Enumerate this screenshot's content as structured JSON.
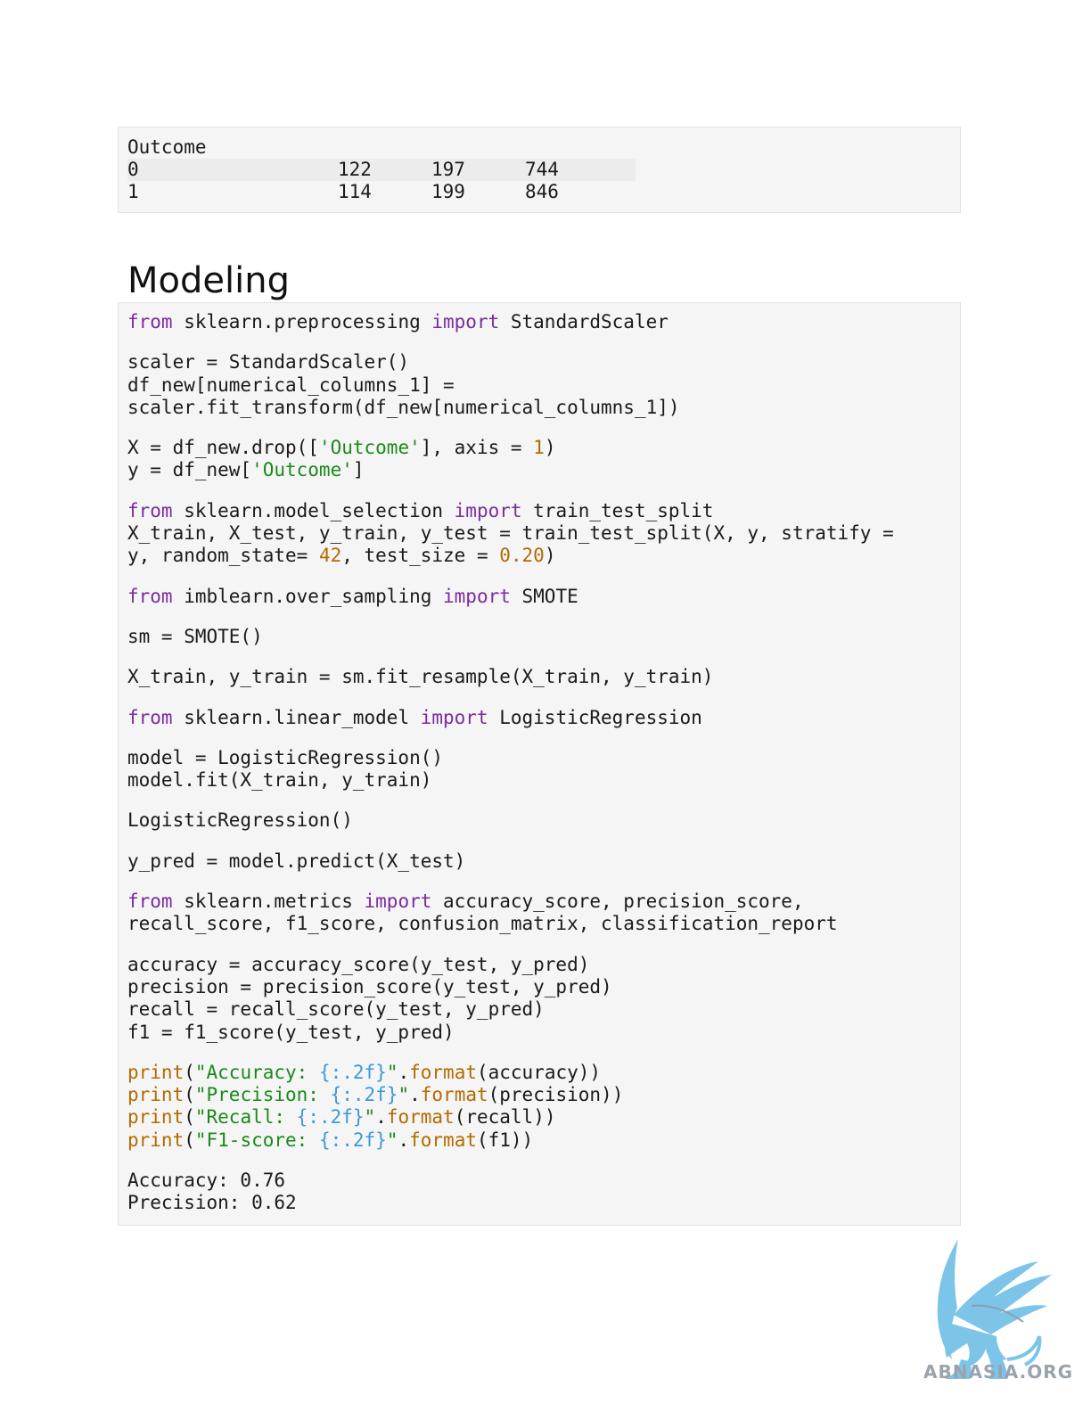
{
  "output_table": {
    "header": "Outcome",
    "rows": [
      {
        "label": "0",
        "v1": "122",
        "v2": "197",
        "v3": "744"
      },
      {
        "label": "1",
        "v1": "114",
        "v2": "199",
        "v3": "846"
      }
    ]
  },
  "heading": "Modeling",
  "code": {
    "l1": {
      "a": "from",
      "b": " sklearn.preprocessing ",
      "c": "import",
      "d": " StandardScaler"
    },
    "l2": "scaler = StandardScaler()",
    "l3": "df_new[numerical_columns_1] =",
    "l4": "scaler.fit_transform(df_new[numerical_columns_1])",
    "l5": {
      "a": "X = df_new.drop([",
      "b": "'Outcome'",
      "c": "], axis = ",
      "d": "1",
      "e": ")"
    },
    "l6": {
      "a": "y = df_new[",
      "b": "'Outcome'",
      "c": "]"
    },
    "l7": {
      "a": "from",
      "b": " sklearn.model_selection ",
      "c": "import",
      "d": " train_test_split"
    },
    "l8": "X_train, X_test, y_train, y_test = train_test_split(X, y, stratify =",
    "l9": {
      "a": "y, random_state= ",
      "b": "42",
      "c": ", test_size = ",
      "d": "0.20",
      "e": ")"
    },
    "l10": {
      "a": "from",
      "b": " imblearn.over_sampling ",
      "c": "import",
      "d": " SMOTE"
    },
    "l11": "sm = SMOTE()",
    "l12": "X_train, y_train = sm.fit_resample(X_train, y_train)",
    "l13": {
      "a": "from",
      "b": " sklearn.linear_model ",
      "c": "import",
      "d": " LogisticRegression"
    },
    "l14": "model = LogisticRegression()",
    "l15": "model.fit(X_train, y_train)",
    "l16": "LogisticRegression()",
    "l17": "y_pred = model.predict(X_test)",
    "l18": {
      "a": "from",
      "b": " sklearn.metrics ",
      "c": "import",
      "d": " accuracy_score, precision_score,"
    },
    "l19": "recall_score, f1_score, confusion_matrix, classification_report",
    "l20": "accuracy = accuracy_score(y_test, y_pred)",
    "l21": "precision = precision_score(y_test, y_pred)",
    "l22": "recall = recall_score(y_test, y_pred)",
    "l23": "f1 = f1_score(y_test, y_pred)",
    "p1": {
      "fn": "print",
      "o": "(",
      "s": "\"Accuracy: ",
      "f": "{:.2f}",
      "q": "\"",
      "dot": ".",
      "m": "format",
      "r": "(accuracy))"
    },
    "p2": {
      "fn": "print",
      "o": "(",
      "s": "\"Precision: ",
      "f": "{:.2f}",
      "q": "\"",
      "dot": ".",
      "m": "format",
      "r": "(precision))"
    },
    "p3": {
      "fn": "print",
      "o": "(",
      "s": "\"Recall: ",
      "f": "{:.2f}",
      "q": "\"",
      "dot": ".",
      "m": "format",
      "r": "(recall))"
    },
    "p4": {
      "fn": "print",
      "o": "(",
      "s": "\"F1-score: ",
      "f": "{:.2f}",
      "q": "\"",
      "dot": ".",
      "m": "format",
      "r": "(f1))"
    },
    "o1": "Accuracy: 0.76",
    "o2": "Precision: 0.62"
  },
  "logo": {
    "text": "ABNASIA.ORG",
    "color": "#7cc4e8"
  }
}
